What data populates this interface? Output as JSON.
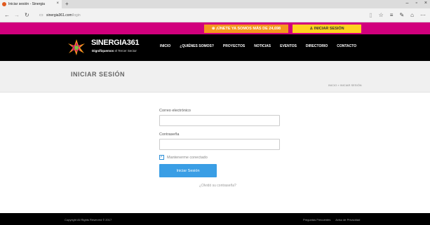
{
  "browser": {
    "tab_title": "Iniciar sesión - Sinergia",
    "tab_close": "×",
    "new_tab": "+",
    "window_controls": [
      "–",
      "▫",
      "×"
    ],
    "url_domain": "sinergia361.com",
    "url_path": "/login"
  },
  "promo": {
    "join": "⊕ ¡ÚNETE YA SOMOS MÁS DE 24,698",
    "login": "♙ INICIAR SESIÓN"
  },
  "header": {
    "brand": "SINERGIA361",
    "tagline_bold": "Dignifiquemos",
    "tagline_rest": " el Tercer Sector",
    "menu": [
      "INICIO",
      "¿QUIÉNES SOMOS?",
      "PROYECTOS",
      "NOTICIAS",
      "EVENTOS",
      "DIRECTORIO",
      "CONTACTO"
    ]
  },
  "page": {
    "title": "INICIAR SESIÓN",
    "breadcrumb": "INICIO » INICIAR SESIÓN"
  },
  "form": {
    "email_label": "Correo electrónico",
    "email_value": "",
    "password_label": "Contraseña",
    "password_value": "",
    "remember_label": "Mantenerme conectado",
    "remember_checked": true,
    "submit_label": "Iniciar Sesión",
    "forgot_link": "¿Olvidó su contraseña?"
  },
  "footer": {
    "copyright": "Copyright All Rights Reserved © 2017",
    "links": [
      "Preguntas Frecuentes",
      "Aviso de Privacidad"
    ]
  },
  "colors": {
    "magenta": "#d1007d",
    "orange": "#f5971d",
    "yellow": "#ffd21e",
    "button_blue": "#3a9ee5"
  }
}
